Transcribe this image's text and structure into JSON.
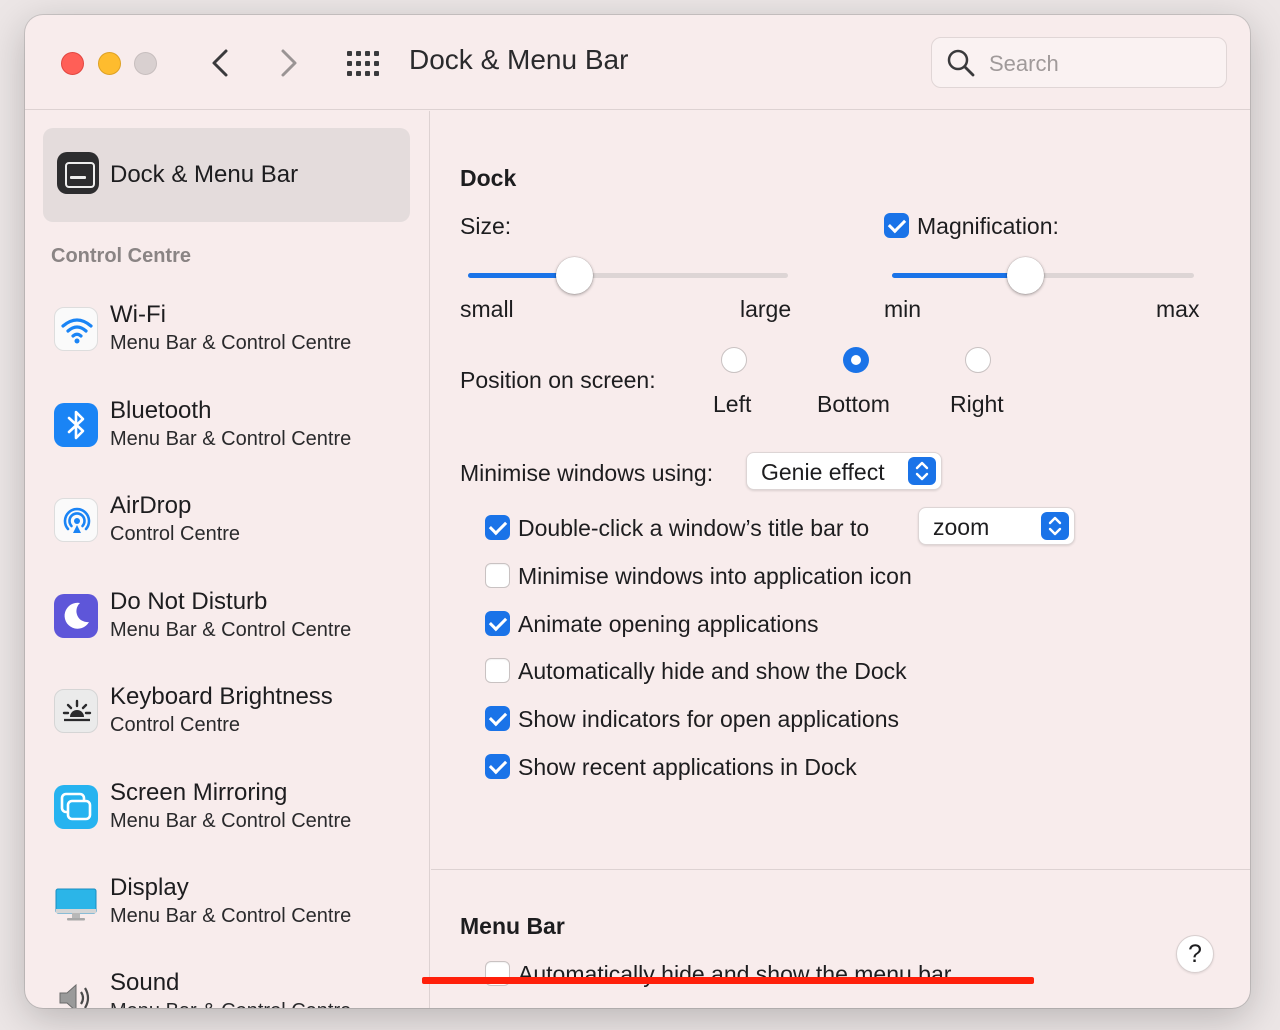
{
  "window": {
    "title": "Dock & Menu Bar",
    "search_placeholder": "Search"
  },
  "sidebar": {
    "selected": {
      "label": "Dock & Menu Bar",
      "icon": "dock-menubar-icon"
    },
    "section_label": "Control Centre",
    "items": [
      {
        "title": "Wi-Fi",
        "subtitle": "Menu Bar & Control Centre",
        "icon": "wifi-icon"
      },
      {
        "title": "Bluetooth",
        "subtitle": "Menu Bar & Control Centre",
        "icon": "bluetooth-icon"
      },
      {
        "title": "AirDrop",
        "subtitle": "Control Centre",
        "icon": "airdrop-icon"
      },
      {
        "title": "Do Not Disturb",
        "subtitle": "Menu Bar & Control Centre",
        "icon": "moon-icon"
      },
      {
        "title": "Keyboard Brightness",
        "subtitle": "Control Centre",
        "icon": "keyboard-brightness-icon"
      },
      {
        "title": "Screen Mirroring",
        "subtitle": "Menu Bar & Control Centre",
        "icon": "screen-mirroring-icon"
      },
      {
        "title": "Display",
        "subtitle": "Menu Bar & Control Centre",
        "icon": "display-icon"
      },
      {
        "title": "Sound",
        "subtitle": "Menu Bar & Control Centre",
        "icon": "speaker-icon"
      }
    ]
  },
  "dock": {
    "heading": "Dock",
    "size": {
      "label": "Size:",
      "min_label": "small",
      "max_label": "large",
      "value": 0.33
    },
    "magnification": {
      "label": "Magnification:",
      "checked": true,
      "min_label": "min",
      "max_label": "max",
      "value": 0.44
    },
    "position": {
      "label": "Position on screen:",
      "options": [
        "Left",
        "Bottom",
        "Right"
      ],
      "selected": "Bottom"
    },
    "minimise_using": {
      "label": "Minimise windows using:",
      "value": "Genie effect"
    },
    "double_click": {
      "label": "Double-click a window’s title bar to",
      "checked": true,
      "value": "zoom"
    },
    "minimise_into_icon": {
      "label": "Minimise windows into application icon",
      "checked": false
    },
    "animate": {
      "label": "Animate opening applications",
      "checked": true
    },
    "autohide": {
      "label": "Automatically hide and show the Dock",
      "checked": false
    },
    "indicators": {
      "label": "Show indicators for open applications",
      "checked": true
    },
    "recent": {
      "label": "Show recent applications in Dock",
      "checked": true
    }
  },
  "menubar": {
    "heading": "Menu Bar",
    "autohide": {
      "label": "Automatically hide and show the menu bar",
      "checked": false
    }
  },
  "help": {
    "label": "?"
  },
  "colors": {
    "accent": "#1a73e8",
    "annotation_underline": "#ff1f0a"
  }
}
